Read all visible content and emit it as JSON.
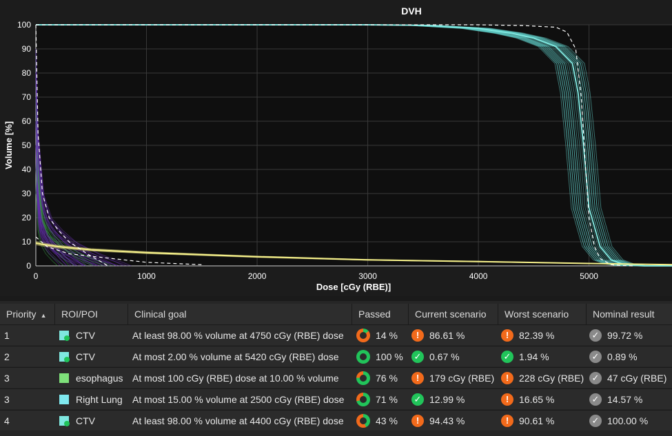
{
  "chart_data": {
    "type": "line",
    "title": "DVH",
    "xlabel": "Dose [cGy (RBE)]",
    "ylabel": "Volume [%]",
    "xlim": [
      0,
      5750
    ],
    "ylim": [
      0,
      100
    ],
    "x_ticks": [
      0,
      1000,
      2000,
      3000,
      4000,
      5000
    ],
    "y_ticks": [
      0,
      10,
      20,
      30,
      40,
      50,
      60,
      70,
      80,
      90,
      100
    ],
    "grid": true,
    "series": [
      {
        "color": "#7fe8e0",
        "kind": "ctv-nominal",
        "x": [
          0,
          3000,
          3500,
          4000,
          4300,
          4500,
          4700,
          4850,
          4900,
          4950,
          5000,
          5100,
          5200,
          5300,
          5400,
          5500,
          5750
        ],
        "y": [
          100,
          100,
          99.8,
          98.5,
          96.5,
          94.5,
          91,
          84,
          72,
          50,
          24,
          8,
          2.5,
          0.8,
          0.2,
          0,
          0
        ]
      },
      {
        "color": "#ffffff",
        "kind": "ctv-dashed",
        "x": [
          0,
          3500,
          4000,
          4400,
          4700,
          4800,
          4880,
          4930,
          4970,
          5000,
          5050,
          5100,
          5200,
          5300,
          5400
        ],
        "y": [
          100,
          100,
          100,
          99.7,
          99,
          97,
          90,
          70,
          40,
          20,
          8,
          3,
          0.5,
          0.1,
          0
        ]
      },
      {
        "color": "#f5f08a",
        "kind": "right-lung-nominal",
        "x": [
          0,
          50,
          200,
          500,
          1000,
          2000,
          3000,
          4000,
          5000,
          5750
        ],
        "y": [
          9.5,
          9,
          8,
          6.7,
          5.5,
          3.8,
          2.5,
          1.8,
          1,
          0.5
        ]
      },
      {
        "color": "#ffffff",
        "kind": "esophagus-dashed",
        "x": [
          0,
          20,
          60,
          120,
          200,
          300,
          400,
          500,
          600,
          650
        ],
        "y": [
          100,
          55,
          30,
          20,
          15,
          10,
          7,
          4,
          1.5,
          0
        ]
      },
      {
        "color": "#ffffff",
        "kind": "lung-dashed",
        "x": [
          0,
          100,
          300,
          500,
          800,
          1000,
          1500
        ],
        "y": [
          12,
          8,
          5,
          4,
          2.5,
          1.5,
          0.5
        ]
      }
    ]
  },
  "table": {
    "headers": {
      "priority": "Priority",
      "roi": "ROI/POI",
      "goal": "Clinical goal",
      "passed": "Passed",
      "current": "Current scenario",
      "worst": "Worst scenario",
      "nominal": "Nominal result"
    },
    "rows": [
      {
        "priority": "1",
        "roi": "CTV",
        "roi_icon": "ctv-icon",
        "goal": "At least 98.00 % volume at 4750 cGy (RBE) dose",
        "passed": "14 %",
        "passed_frac": 0.14,
        "current": "86.61 %",
        "current_status": "warning",
        "worst": "82.39 %",
        "worst_status": "warning",
        "nominal": "99.72 %"
      },
      {
        "priority": "2",
        "roi": "CTV",
        "roi_icon": "ctv-icon",
        "goal": "At most 2.00 % volume at 5420 cGy (RBE) dose",
        "passed": "100 %",
        "passed_frac": 1.0,
        "current": "0.67 %",
        "current_status": "ok",
        "worst": "1.94 %",
        "worst_status": "ok",
        "nominal": "0.89 %"
      },
      {
        "priority": "3",
        "roi": "esophagus",
        "roi_icon": "esophagus-icon",
        "goal": "At most 100 cGy (RBE) dose at 10.00 % volume",
        "passed": "76 %",
        "passed_frac": 0.76,
        "current": "179 cGy (RBE)",
        "current_status": "warning",
        "worst": "228 cGy (RBE)",
        "worst_status": "warning",
        "nominal": "47 cGy (RBE)"
      },
      {
        "priority": "3",
        "roi": "Right Lung",
        "roi_icon": "lung-icon",
        "goal": "At most 15.00 % volume at 2500 cGy (RBE) dose",
        "passed": "71 %",
        "passed_frac": 0.71,
        "current": "12.99 %",
        "current_status": "ok",
        "worst": "16.65 %",
        "worst_status": "warning",
        "nominal": "14.57 %"
      },
      {
        "priority": "4",
        "roi": "CTV",
        "roi_icon": "ctv-icon",
        "goal": "At least 98.00 % volume at 4400 cGy (RBE) dose",
        "passed": "43 %",
        "passed_frac": 0.43,
        "current": "94.43 %",
        "current_status": "warning",
        "worst": "90.61 %",
        "worst_status": "warning",
        "nominal": "100.00 %"
      }
    ]
  },
  "colors": {
    "ctv": "#7fe8e0",
    "esophagus": "#7ee07a",
    "lung": "#7fe8ef",
    "passed_green": "#21c45a",
    "passed_orange": "#f26a1b",
    "warning": "#f26a1b",
    "ok": "#21c45a",
    "nominal": "#8a8a8a"
  }
}
